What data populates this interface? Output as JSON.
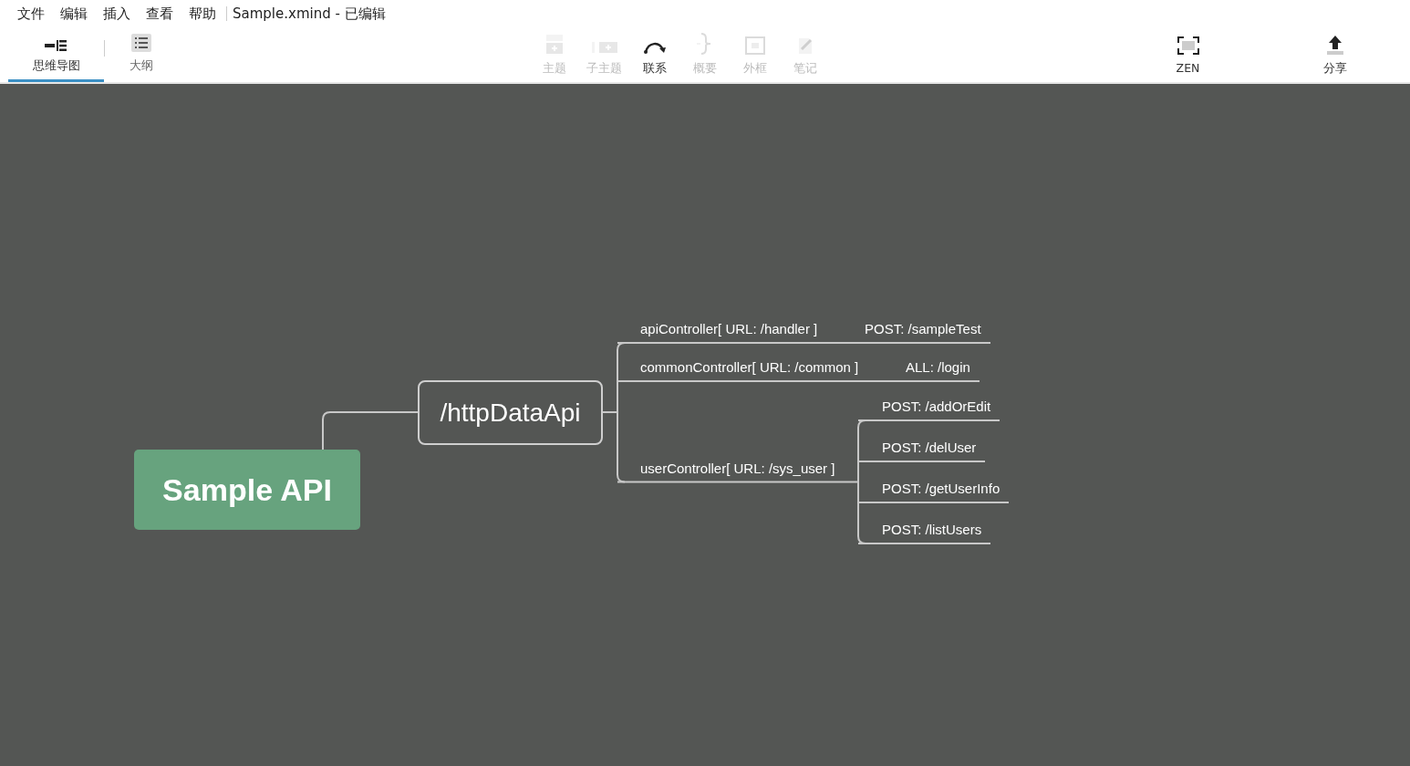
{
  "menu": [
    {
      "label": "文件"
    },
    {
      "label": "编辑"
    },
    {
      "label": "插入"
    },
    {
      "label": "查看"
    },
    {
      "label": "帮助"
    }
  ],
  "document_title": "Sample.xmind - 已编辑",
  "view_tabs": [
    {
      "label": "思维导图",
      "selected": true
    },
    {
      "label": "大纲",
      "selected": false
    }
  ],
  "tools": [
    {
      "label": "主题",
      "kind": "topic",
      "disabled": true
    },
    {
      "label": "子主题",
      "kind": "subtopic",
      "disabled": true
    },
    {
      "label": "联系",
      "kind": "relation",
      "disabled": false
    },
    {
      "label": "概要",
      "kind": "summary",
      "disabled": true
    },
    {
      "label": "外框",
      "kind": "boundary",
      "disabled": true
    },
    {
      "label": "笔记",
      "kind": "note",
      "disabled": true
    }
  ],
  "right_tools": [
    {
      "label": "ZEN",
      "kind": "zen"
    },
    {
      "label": "分享",
      "kind": "share"
    }
  ],
  "mindmap": {
    "central_topic": "Sample API",
    "main_topic": "/httpDataApi",
    "subtopics": [
      {
        "text": "apiController[ URL: /handler ]",
        "children": [
          {
            "text": "POST: /sampleTest"
          }
        ]
      },
      {
        "text": "commonController[ URL: /common ]",
        "children": [
          {
            "text": "ALL: /login"
          }
        ]
      },
      {
        "text": "userController[ URL: /sys_user ]",
        "children": [
          {
            "text": "POST: /addOrEdit"
          },
          {
            "text": "POST: /delUser"
          },
          {
            "text": "POST: /getUserInfo"
          },
          {
            "text": "POST: /listUsers"
          }
        ]
      }
    ]
  }
}
